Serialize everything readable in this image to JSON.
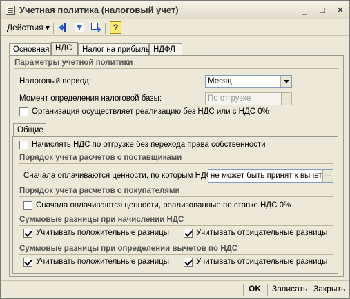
{
  "window": {
    "title": "Учетная политика (налоговый учет)",
    "controls": {
      "minimize": "_",
      "maximize": "□",
      "close": "✕"
    }
  },
  "toolbar": {
    "menu_label": "Действия ▾",
    "icons": [
      "arrow-left-icon",
      "filter-icon",
      "refresh-icon"
    ],
    "help_label": "?"
  },
  "tabs": [
    {
      "label": "Основная",
      "active": false
    },
    {
      "label": "НДС",
      "active": true
    },
    {
      "label": "Налог на прибыль",
      "active": false
    },
    {
      "label": "НДФЛ",
      "active": false
    }
  ],
  "policy": {
    "section_title": "Параметры учетной политики",
    "tax_period_label": "Налоговый период:",
    "tax_period_value": "Месяц",
    "base_moment_label": "Момент определения налоговой базы:",
    "base_moment_value": "По отгрузке",
    "no_vat_label": "Организация осуществляет реализацию без НДС или с НДС 0%",
    "no_vat_checked": false
  },
  "inner_tab": {
    "label": "Общие"
  },
  "general": {
    "vat_on_shipment_label": "Начислять НДС по отгрузке без перехода права собственности",
    "vat_on_shipment_checked": false,
    "suppliers_title": "Порядок учета расчетов с поставщиками",
    "suppliers_first_label": "Сначала оплачиваются ценности, по которым НДС",
    "suppliers_first_value": "не может быть принят к вычету",
    "buyers_title": "Порядок учета расчетов с покупателями",
    "buyers_first_label": "Сначала оплачиваются ценности, реализованные по ставке НДС 0%",
    "buyers_first_checked": false,
    "accrual_diff_title": "Суммовые разницы при начислении НДС",
    "accrual_positive_label": "Учитывать положительные разницы",
    "accrual_positive_checked": true,
    "accrual_negative_label": "Учитывать отрицательные разницы",
    "accrual_negative_checked": true,
    "deduction_diff_title": "Суммовые разницы при определении вычетов по НДС",
    "deduction_positive_label": "Учитывать положительные разницы",
    "deduction_positive_checked": true,
    "deduction_negative_label": "Учитывать отрицательные разницы",
    "deduction_negative_checked": true
  },
  "buttons": {
    "ok": "OK",
    "save": "Записать",
    "close": "Закрыть"
  }
}
